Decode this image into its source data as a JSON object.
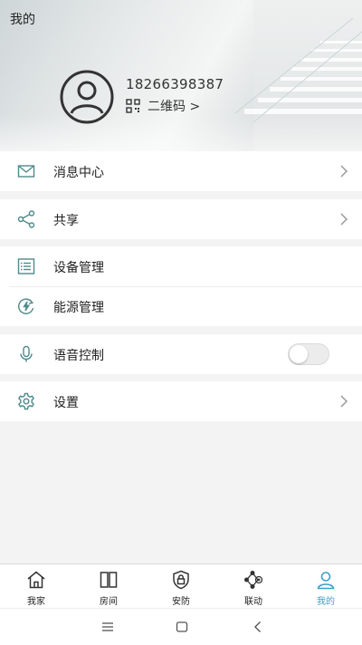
{
  "header": {
    "title": "我的",
    "phone": "18266398387",
    "qr_label": "二维码 >"
  },
  "menu": {
    "messages": "消息中心",
    "share": "共享",
    "devices": "设备管理",
    "energy": "能源管理",
    "voice": "语音控制",
    "settings": "设置"
  },
  "voice_toggle_on": false,
  "tabs": [
    "我家",
    "房间",
    "安防",
    "联动",
    "我的"
  ],
  "active_tab": "我的",
  "colors": {
    "accent": "#3c9fc9",
    "icon": "#4f8a8b",
    "background": "#f3f3f3"
  },
  "icons": {
    "messages": "mail-icon",
    "share": "share-icon",
    "devices": "list-icon",
    "energy": "energy-icon",
    "voice": "microphone-icon",
    "settings": "gear-icon"
  }
}
